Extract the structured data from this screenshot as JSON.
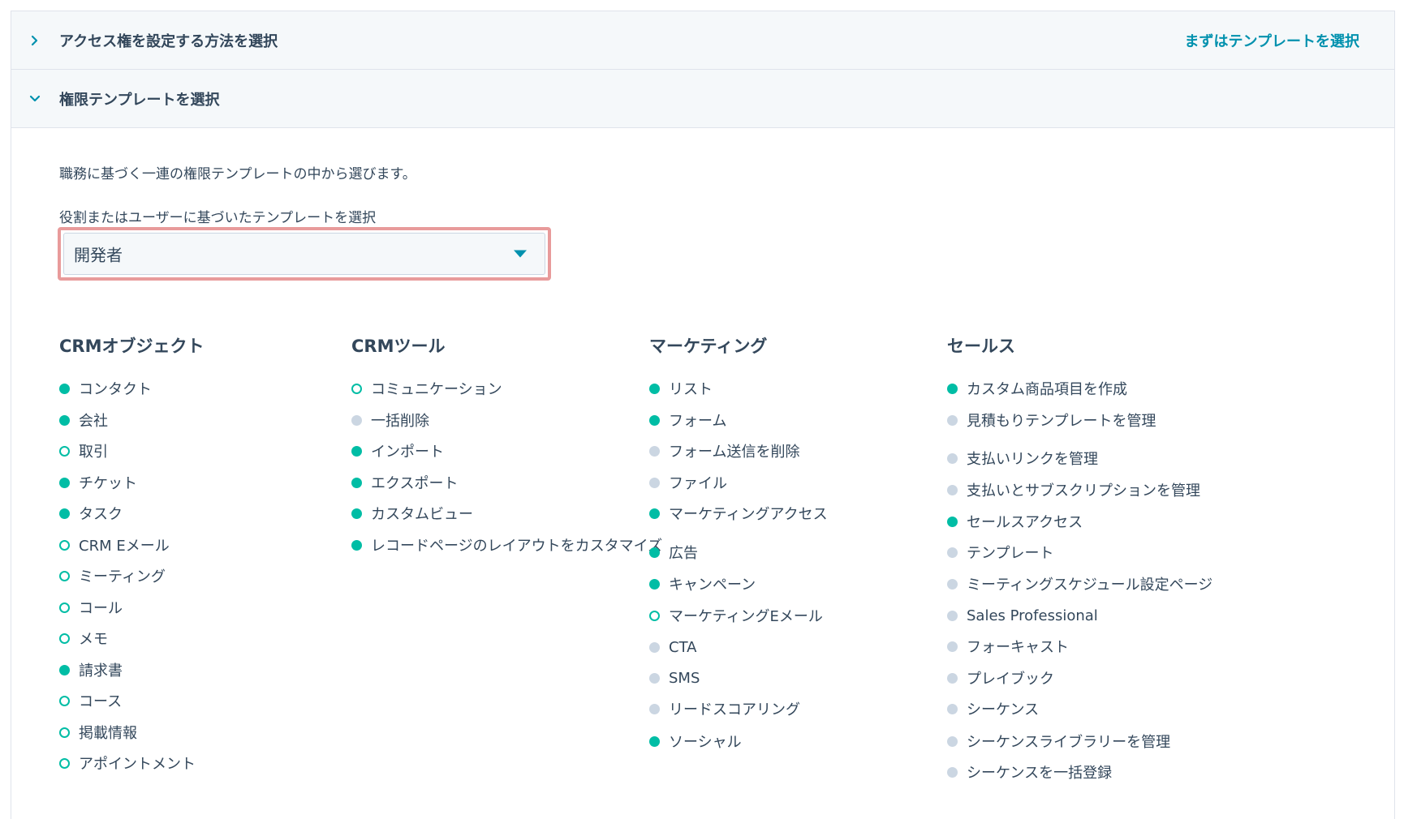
{
  "accordion": {
    "row1": {
      "title": "アクセス権を設定する方法を選択",
      "action": "まずはテンプレートを選択"
    },
    "row2": {
      "title": "権限テンプレートを選択"
    }
  },
  "description": "職務に基づく一連の権限テンプレートの中から選びます。",
  "select": {
    "label": "役割またはユーザーに基づいたテンプレートを選択",
    "value": "開発者"
  },
  "colors": {
    "full": "#00bda5",
    "none": "#cbd6e2",
    "accent": "#0091ae",
    "highlight": "#e89b9b"
  },
  "columns": [
    {
      "title": "CRMオブジェクト",
      "items": [
        {
          "label": "コンタクト",
          "status": "full"
        },
        {
          "label": "会社",
          "status": "full"
        },
        {
          "label": "取引",
          "status": "partial"
        },
        {
          "label": "チケット",
          "status": "full"
        },
        {
          "label": "タスク",
          "status": "full"
        },
        {
          "label": "CRM Eメール",
          "status": "partial"
        },
        {
          "label": "ミーティング",
          "status": "partial"
        },
        {
          "label": "コール",
          "status": "partial"
        },
        {
          "label": "メモ",
          "status": "partial"
        },
        {
          "label": "請求書",
          "status": "full"
        },
        {
          "label": "コース",
          "status": "partial"
        },
        {
          "label": "掲載情報",
          "status": "partial"
        },
        {
          "label": "アポイントメント",
          "status": "partial"
        }
      ]
    },
    {
      "title": "CRMツール",
      "items": [
        {
          "label": "コミュニケーション",
          "status": "partial"
        },
        {
          "label": "一括削除",
          "status": "none"
        },
        {
          "label": "インポート",
          "status": "full"
        },
        {
          "label": "エクスポート",
          "status": "full"
        },
        {
          "label": "カスタムビュー",
          "status": "full"
        },
        {
          "label": "レコードページのレイアウトをカスタマイズ",
          "status": "full"
        }
      ]
    },
    {
      "title": "マーケティング",
      "items": [
        {
          "label": "リスト",
          "status": "full"
        },
        {
          "label": "フォーム",
          "status": "full"
        },
        {
          "label": "フォーム送信を削除",
          "status": "none"
        },
        {
          "label": "ファイル",
          "status": "none"
        },
        {
          "label": "マーケティングアクセス",
          "status": "full"
        },
        {
          "label": "広告",
          "status": "full"
        },
        {
          "label": "キャンペーン",
          "status": "full"
        },
        {
          "label": "マーケティングEメール",
          "status": "partial"
        },
        {
          "label": "CTA",
          "status": "none"
        },
        {
          "label": "SMS",
          "status": "none"
        },
        {
          "label": "リードスコアリング",
          "status": "none"
        },
        {
          "label": "ソーシャル",
          "status": "full"
        }
      ]
    },
    {
      "title": "セールス",
      "items": [
        {
          "label": "カスタム商品項目を作成",
          "status": "full"
        },
        {
          "label": "見積もりテンプレートを管理",
          "status": "none"
        },
        {
          "label": "支払いリンクを管理",
          "status": "none"
        },
        {
          "label": "支払いとサブスクリプションを管理",
          "status": "none"
        },
        {
          "label": "セールスアクセス",
          "status": "full"
        },
        {
          "label": "テンプレート",
          "status": "none"
        },
        {
          "label": "ミーティングスケジュール設定ページ",
          "status": "none"
        },
        {
          "label": "Sales Professional",
          "status": "none"
        },
        {
          "label": "フォーキャスト",
          "status": "none"
        },
        {
          "label": "プレイブック",
          "status": "none"
        },
        {
          "label": "シーケンス",
          "status": "none"
        },
        {
          "label": "シーケンスライブラリーを管理",
          "status": "none"
        },
        {
          "label": "シーケンスを一括登録",
          "status": "none"
        }
      ]
    }
  ]
}
